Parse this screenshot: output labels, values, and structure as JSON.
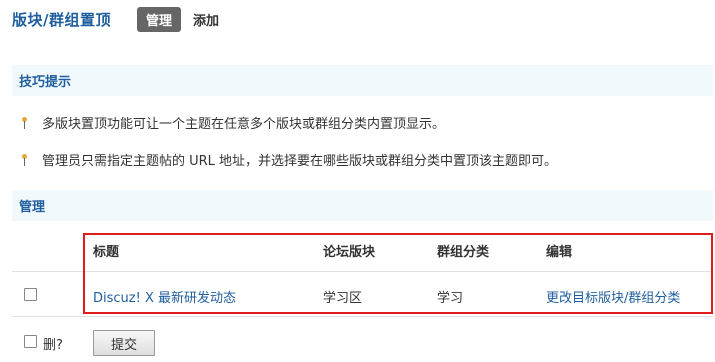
{
  "header": {
    "title": "版块/群组置顶",
    "tabs": [
      {
        "label": "管理",
        "active": true
      },
      {
        "label": "添加",
        "active": false
      }
    ]
  },
  "tips": {
    "title": "技巧提示",
    "items": [
      "多版块置顶功能可让一个主题在任意多个版块或群组分类内置顶显示。",
      "管理员只需指定主题帖的 URL 地址，并选择要在哪些版块或群组分类中置顶该主题即可。"
    ]
  },
  "manage": {
    "title": "管理",
    "columns": [
      "标题",
      "论坛版块",
      "群组分类",
      "编辑"
    ],
    "rows": [
      {
        "title": "Discuz! X 最新研发动态",
        "forum": "学习区",
        "group": "学习",
        "edit": "更改目标版块/群组分类"
      }
    ]
  },
  "footer": {
    "delete_label": "删?",
    "submit_label": "提交"
  },
  "colors": {
    "accent": "#1f5e9e",
    "highlight_border": "#e01b1b",
    "section_bg": "#f2f9fd"
  }
}
